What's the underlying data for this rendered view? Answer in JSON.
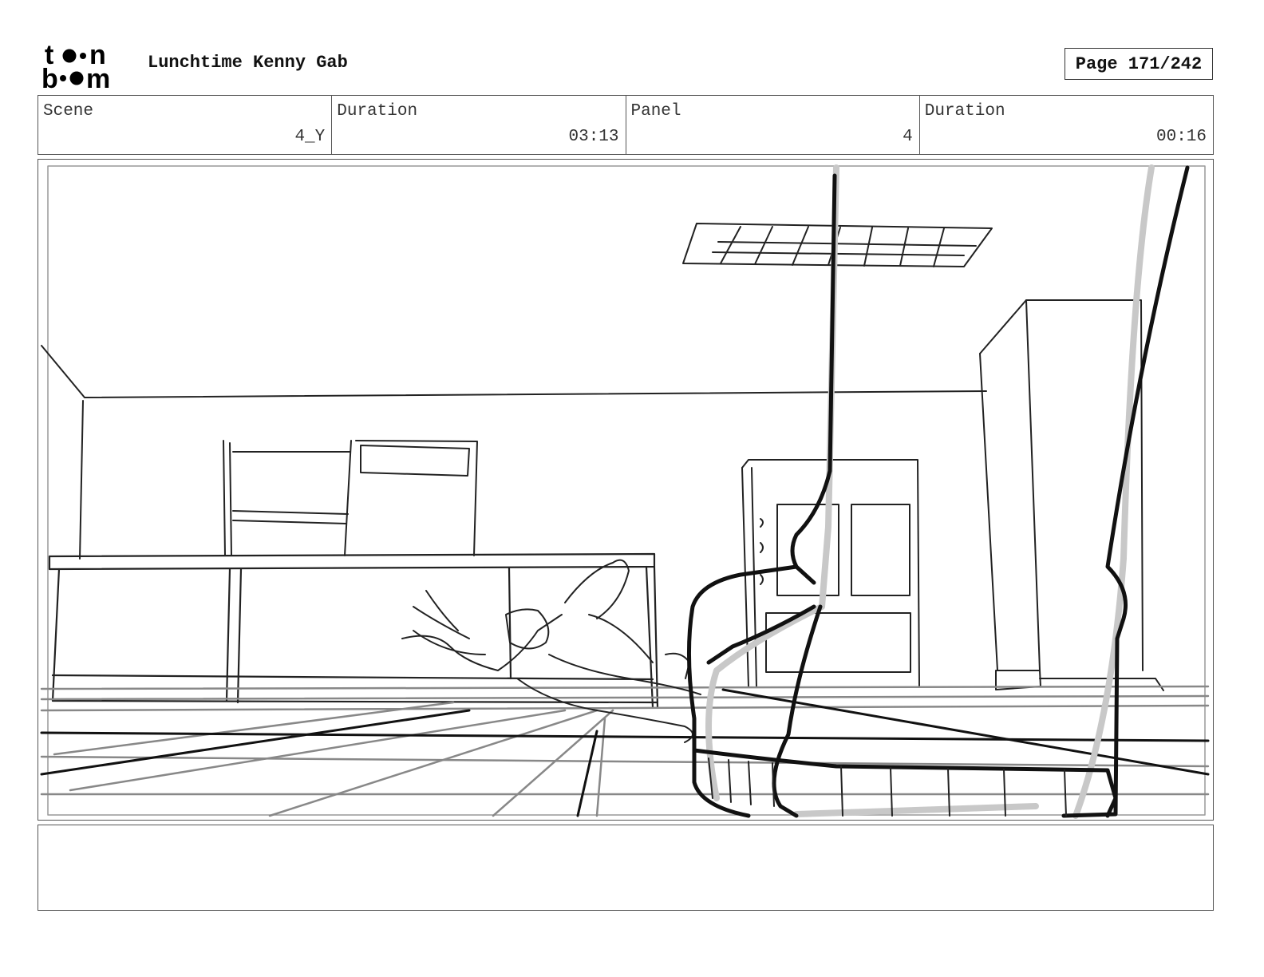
{
  "header": {
    "logo_icon": "toon-boom-logo",
    "project_title": "Lunchtime Kenny Gab",
    "page_label": "Page 171/242"
  },
  "info": {
    "scene_label": "Scene",
    "scene_value": "4_Y",
    "scene_duration_label": "Duration",
    "scene_duration_value": "03:13",
    "panel_label": "Panel",
    "panel_value": "4",
    "panel_duration_label": "Duration",
    "panel_duration_value": "00:16"
  },
  "panel": {
    "image_icon": "storyboard-sketch-image"
  },
  "notes": {
    "text": ""
  }
}
